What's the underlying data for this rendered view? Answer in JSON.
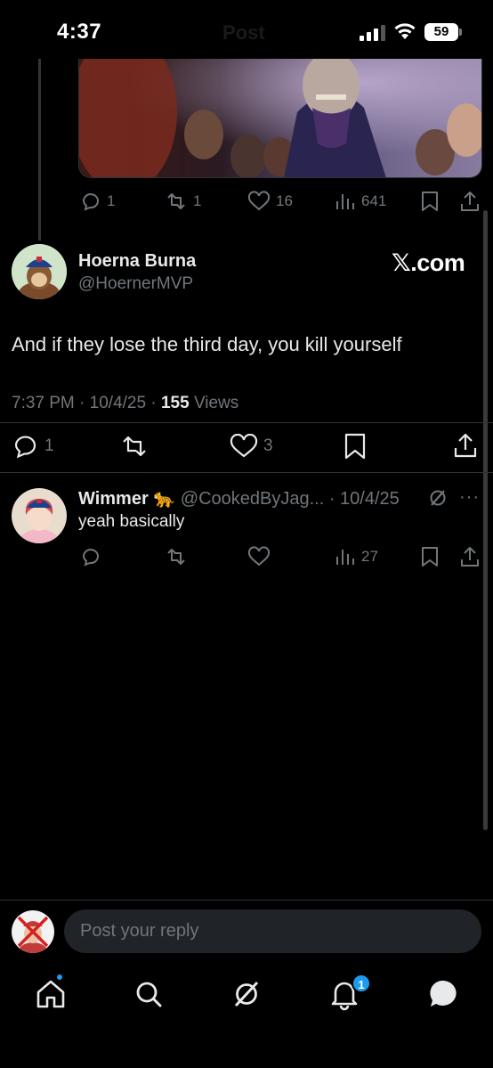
{
  "status_bar": {
    "time": "4:37",
    "battery": "59",
    "ghost_title": "Post"
  },
  "quoted_tweet_actions": {
    "replies": "1",
    "reposts": "1",
    "likes": "16",
    "views": "641"
  },
  "main_tweet": {
    "display_name": "Hoerna Burna",
    "handle": "@HoernerMVP",
    "source_badge": "𝕏.com",
    "text": "And if they lose the third day, you kill yourself",
    "time": "7:37 PM",
    "date": "10/4/25",
    "views_count": "155",
    "views_label": "Views",
    "replies": "1",
    "likes": "3"
  },
  "reply": {
    "display_name": "Wimmer 🐆",
    "handle": "@CookedByJag...",
    "date": "10/4/25",
    "text": "yeah basically",
    "views": "27"
  },
  "composer": {
    "placeholder": "Post your reply"
  },
  "nav": {
    "notifications_badge": "1"
  },
  "colors": {
    "accent": "#1d9bf0",
    "muted": "#71767b",
    "background": "#000000"
  }
}
